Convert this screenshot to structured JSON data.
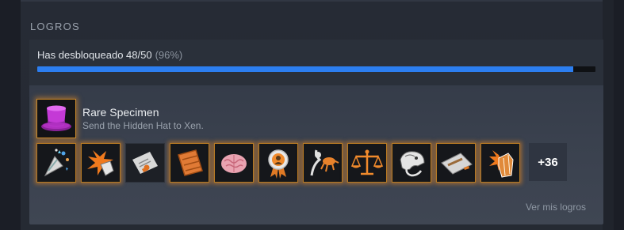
{
  "section": {
    "title": "LOGROS"
  },
  "progress": {
    "label": "Has desbloqueado 48/50",
    "percent_text": "(96%)",
    "fraction": 0.96
  },
  "featured": {
    "name": "Rare Specimen",
    "description": "Send the Hidden Hat to Xen.",
    "icon": "purple-top-hat-icon"
  },
  "achievements": [
    {
      "icon": "party-popper-icon",
      "highlighted": true
    },
    {
      "icon": "explosion-hand-icon",
      "highlighted": true
    },
    {
      "icon": "pamphlet-flyer-icon",
      "highlighted": false
    },
    {
      "icon": "wood-plank-icon",
      "highlighted": true
    },
    {
      "icon": "brain-icon",
      "highlighted": true
    },
    {
      "icon": "award-ribbon-icon",
      "highlighted": true
    },
    {
      "icon": "headcrab-leaping-icon",
      "highlighted": true
    },
    {
      "icon": "balance-scale-icon",
      "highlighted": true
    },
    {
      "icon": "vortigaunt-head-icon",
      "highlighted": true
    },
    {
      "icon": "welcome-mat-icon",
      "highlighted": true
    },
    {
      "icon": "smashed-crystal-icon",
      "highlighted": true
    }
  ],
  "more_count": "+36",
  "view_link": "Ver mis logros",
  "colors": {
    "progress_fill": "#2c7ef0",
    "glow": "#e28c28",
    "hat": "#c43ad6"
  }
}
